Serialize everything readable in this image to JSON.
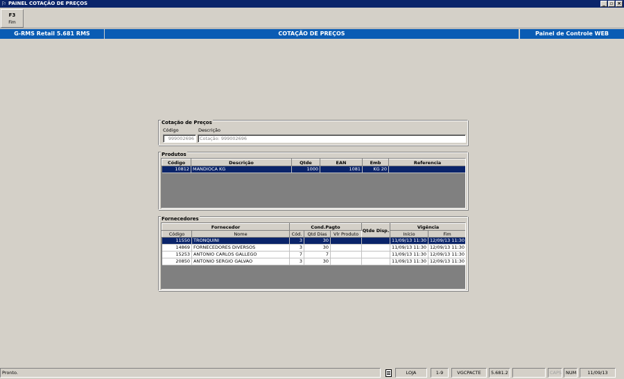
{
  "window": {
    "title": "PAINEL COTAÇÃO DE PREÇOS",
    "buttons": [
      "_",
      "▫",
      "×"
    ]
  },
  "toolbar": {
    "fim_key": "F3",
    "fim_label": "Fim"
  },
  "header": {
    "left": "G-RMS Retail 5.681 RMS",
    "center": "COTAÇÃO DE PREÇOS",
    "right": "Painel de Controle WEB"
  },
  "cotacao": {
    "title": "Cotação de Preços",
    "codigo_label": "Código",
    "descricao_label": "Descrição",
    "codigo_value": "999002696",
    "descricao_value": "Cotação: 999002696"
  },
  "produtos": {
    "title": "Produtos",
    "columns": [
      "Código",
      "Descrição",
      "Qtde",
      "EAN",
      "Emb",
      "Referencia"
    ],
    "rows": [
      {
        "codigo": "10812",
        "descricao": "MANDIOCA KG",
        "qtde": "1000",
        "ean": "1081",
        "emb": "KG 20",
        "referencia": ""
      }
    ]
  },
  "fornecedores": {
    "title": "Fornecedores",
    "group_fornecedor": "Fornecedor",
    "group_cond": "Cond.Pagto",
    "qtde_disp": "Qtde Disp.",
    "group_vigencia": "Vigência",
    "sub_codigo": "Código",
    "sub_nome": "Nome",
    "sub_cod": "Cód.",
    "sub_qtd_dias": "Qtd Dias",
    "sub_vlr": "Vlr Produto",
    "sub_inicio": "Início",
    "sub_fim": "Fim",
    "rows": [
      {
        "codigo": "11550",
        "nome": "TRONQUINI",
        "cod": "3",
        "dias": "30",
        "vlr": "",
        "disp": "",
        "inicio": "11/09/13 11:30",
        "fim": "12/09/13 11:30"
      },
      {
        "codigo": "14869",
        "nome": "FORNECEDORES DIVERSOS",
        "cod": "3",
        "dias": "30",
        "vlr": "",
        "disp": "",
        "inicio": "11/09/13 11:30",
        "fim": "12/09/13 11:30"
      },
      {
        "codigo": "15253",
        "nome": "ANTONIO CARLOS GALLEGO",
        "cod": "7",
        "dias": "7",
        "vlr": "",
        "disp": "",
        "inicio": "11/09/13 11:30",
        "fim": "12/09/13 11:30"
      },
      {
        "codigo": "20850",
        "nome": "ANTONIO SERGIO GALVAO",
        "cod": "3",
        "dias": "30",
        "vlr": "",
        "disp": "",
        "inicio": "11/09/13 11:30",
        "fim": "12/09/13 11:30"
      }
    ]
  },
  "status": {
    "message": "Pronto.",
    "loja": "LOJA",
    "range": "1-9",
    "user": "VGCPACTE",
    "version": "5.681.2",
    "caps": "CAPS",
    "num": "NUM",
    "date": "11/09/13"
  },
  "colors": {
    "title_bar": "#0a246a",
    "header_bar": "#0a5cb4",
    "selection": "#0a246a",
    "background": "#d4d0c8"
  }
}
